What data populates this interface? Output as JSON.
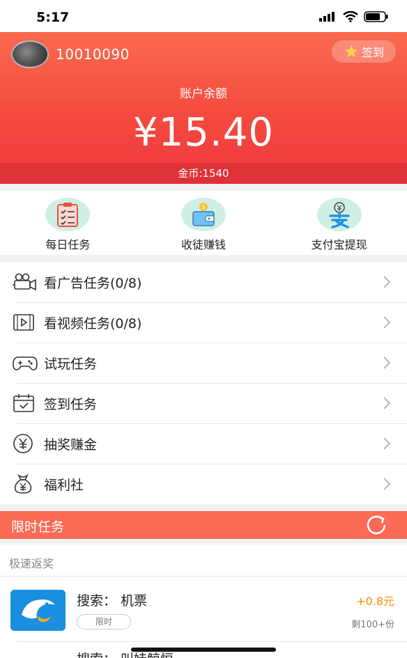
{
  "status_bar": {
    "time": "5:17",
    "icons": [
      "signal-icon",
      "wifi-icon",
      "battery-icon"
    ]
  },
  "header": {
    "user_id": "10010090",
    "signin_label": "签到",
    "balance_label": "账户余额",
    "balance_value": "¥15.40",
    "coins_text": "金币:1540",
    "colors": {
      "gradient_top": "#fb6a4f",
      "gradient_bottom": "#f03840"
    }
  },
  "quick_actions": [
    {
      "label": "每日任务",
      "icon": "clipboard-checklist-icon"
    },
    {
      "label": "收徒赚钱",
      "icon": "wallet-coin-icon"
    },
    {
      "label": "支付宝提现",
      "icon": "alipay-icon"
    }
  ],
  "menu": [
    {
      "label": "看广告任务(0/8)",
      "icon": "video-camera-icon"
    },
    {
      "label": "看视频任务(0/8)",
      "icon": "video-play-icon"
    },
    {
      "label": "试玩任务",
      "icon": "gamepad-icon"
    },
    {
      "label": "签到任务",
      "icon": "calendar-check-icon"
    },
    {
      "label": "抽奖赚金",
      "icon": "yen-coin-icon"
    },
    {
      "label": "福利社",
      "icon": "money-bag-icon"
    }
  ],
  "limited": {
    "title": "限时任务",
    "accent": "#fb6b55"
  },
  "section": {
    "title": "极速返奖"
  },
  "task": {
    "title": "搜索： 机票",
    "reward": "+0.8元",
    "badge": "限时",
    "remaining": "剩100+份",
    "reward_color": "#ff8a00",
    "next_peek": "搜索： 叫娃鲸恒"
  }
}
